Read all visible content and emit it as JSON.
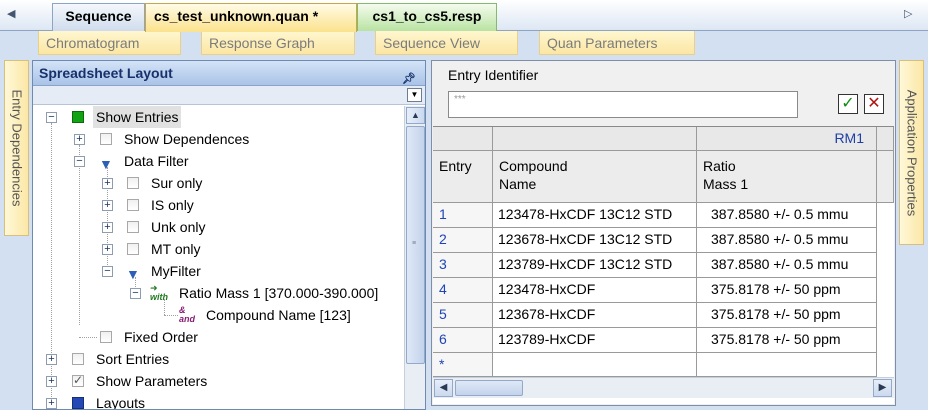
{
  "doc_tabs": [
    "Sequence",
    "cs_test_unknown.quan *",
    "cs1_to_cs5.resp"
  ],
  "view_tabs": [
    "Chromatogram",
    "Response Graph",
    "Sequence View",
    "Quan Parameters"
  ],
  "side_tabs": {
    "left": "Entry Dependencies",
    "right": "Application Properties"
  },
  "colors": {
    "active_tab": "#fbe28c",
    "resp_tab": "#b9e3a2",
    "panel_header": "#a9c3e8",
    "row_number": "#1f44b5"
  },
  "left_panel": {
    "title": "Spreadsheet Layout",
    "tree": {
      "show_entries": "Show Entries",
      "show_dependences": "Show Dependences",
      "data_filter": "Data Filter",
      "sur_only": "Sur only",
      "is_only": "IS only",
      "unk_only": "Unk only",
      "mt_only": "MT only",
      "myfilter": "MyFilter",
      "with_condition": "Ratio Mass 1 [370.000-390.000]",
      "and_condition": "Compound Name [123]",
      "fixed_order": "Fixed Order",
      "sort_entries": "Sort Entries",
      "show_parameters": "Show Parameters",
      "layouts": "Layouts",
      "with_tag": "with",
      "and_tag": "and"
    }
  },
  "right_panel": {
    "entry_identifier_label": "Entry Identifier",
    "entry_identifier_value": "***",
    "group_header": "RM1",
    "columns": {
      "entry": "Entry",
      "compound_l1": "Compound",
      "compound_l2": "Name",
      "ratio_l1": "Ratio",
      "ratio_l2": "Mass 1"
    },
    "rows": [
      {
        "entry": "1",
        "compound": "123478-HxCDF 13C12 STD",
        "ratio": "387.8580  +/- 0.5 mmu"
      },
      {
        "entry": "2",
        "compound": "123678-HxCDF 13C12 STD",
        "ratio": "387.8580  +/- 0.5 mmu"
      },
      {
        "entry": "3",
        "compound": "123789-HxCDF 13C12 STD",
        "ratio": "387.8580  +/- 0.5 mmu"
      },
      {
        "entry": "4",
        "compound": "123478-HxCDF",
        "ratio": "375.8178  +/- 50 ppm"
      },
      {
        "entry": "5",
        "compound": "123678-HxCDF",
        "ratio": "375.8178  +/- 50 ppm"
      },
      {
        "entry": "6",
        "compound": "123789-HxCDF",
        "ratio": "375.8178  +/- 50 ppm"
      }
    ],
    "new_row_marker": "*"
  }
}
